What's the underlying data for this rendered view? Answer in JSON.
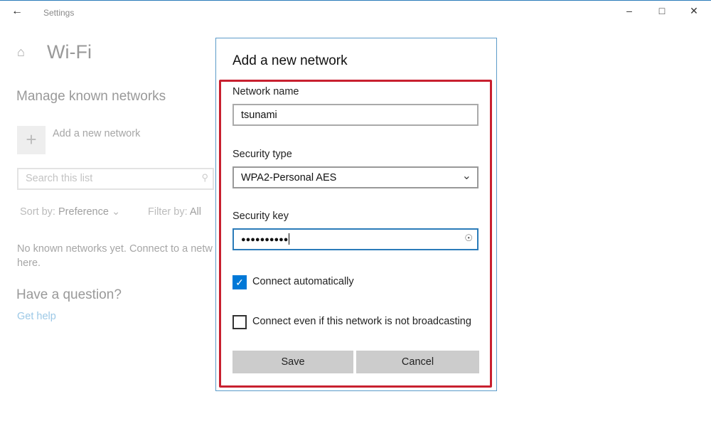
{
  "window": {
    "title": "Settings"
  },
  "page": {
    "title": "Wi-Fi",
    "section": "Manage known networks",
    "add_network": "Add a new network",
    "search_placeholder": "Search this list",
    "sort_label": "Sort by:",
    "sort_value": "Preference",
    "filter_label": "Filter by:",
    "filter_value": "All",
    "empty_text_1": "No known networks yet. Connect to a netw",
    "empty_text_2": "here.",
    "question": "Have a question?",
    "help_link": "Get help"
  },
  "dialog": {
    "title": "Add a new network",
    "network_name_label": "Network name",
    "network_name_value": "tsunami",
    "security_type_label": "Security type",
    "security_type_value": "WPA2-Personal AES",
    "security_key_label": "Security key",
    "security_key_value": "●●●●●●●●●●",
    "connect_auto_label": "Connect automatically",
    "connect_auto_checked": true,
    "connect_hidden_label": "Connect even if this network is not broadcasting",
    "connect_hidden_checked": false,
    "save": "Save",
    "cancel": "Cancel"
  },
  "colors": {
    "accent": "#0078d7",
    "highlight": "#c8202f"
  }
}
